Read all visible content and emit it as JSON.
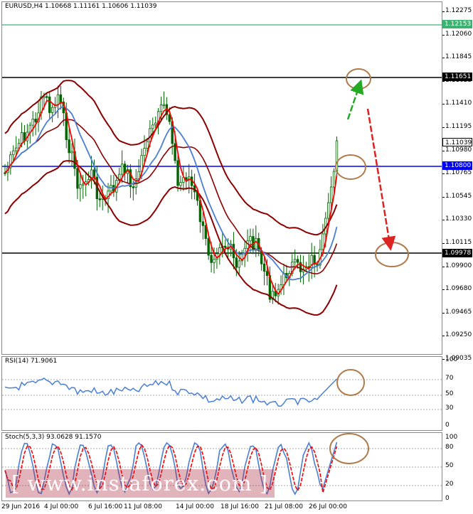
{
  "chart": {
    "symbol_title": "EURUSD,H4  1.10668 1.11161 1.10606 1.11039",
    "price_axis_labels": [
      "1.12275",
      "1.12060",
      "1.11845",
      "1.11625",
      "1.11410",
      "1.11195",
      "1.10980",
      "1.10765",
      "1.10545",
      "1.10330",
      "1.10115",
      "1.09900",
      "1.09680",
      "1.09465",
      "1.09250",
      "1.09035"
    ],
    "level_labels": {
      "green": "1.12153",
      "upper": "1.11651",
      "current": "1.11039",
      "blue": "1.10800",
      "lower": "1.09978"
    },
    "time_labels": [
      "29 Jun 2016",
      "4 Jul 00:00",
      "6 Jul 16:00",
      "11 Jul 08:00",
      "14 Jul 00:00",
      "18 Jul 16:00",
      "21 Jul 08:00",
      "26 Jul 00:00"
    ]
  },
  "rsi": {
    "title": "RSI(14) 71.9061",
    "axis_labels": [
      "100",
      "70",
      "50",
      "30",
      "0"
    ]
  },
  "stoch": {
    "title": "Stoch(5,3,3) 93.0628 91.1570",
    "axis_labels": [
      "100",
      "80",
      "50",
      "20",
      "0"
    ]
  },
  "watermark": "[ www.instaforex.com ]",
  "colors": {
    "candle": "#006400",
    "bollinger": "#8b0000",
    "ma_red": "#ff0000",
    "ma_blue": "#4a7fd4",
    "green_line": "#3cb371",
    "blue_line": "#0000ff",
    "circle": "#b07a4a",
    "arrow_up": "#22aa22",
    "arrow_down": "#dd2222"
  },
  "chart_data": {
    "type": "candlestick",
    "symbol": "EURUSD",
    "timeframe": "H4",
    "ylim": [
      1.09035,
      1.12275
    ],
    "horizontal_levels": [
      1.12153,
      1.11651,
      1.108,
      1.09978
    ],
    "rsi_levels": [
      70,
      50,
      30
    ],
    "stoch_levels": [
      80,
      50,
      20
    ],
    "rsi_last": 71.9061,
    "stoch_last": [
      93.0628,
      91.157
    ]
  }
}
